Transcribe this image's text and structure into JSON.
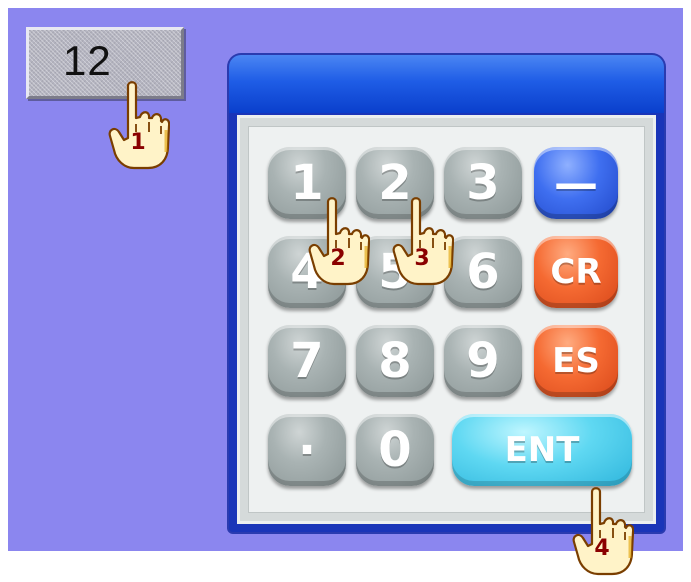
{
  "numeric_input": {
    "value": "12"
  },
  "keypad": {
    "rows": [
      [
        {
          "label": "1",
          "name": "key-1",
          "style": "gray"
        },
        {
          "label": "2",
          "name": "key-2",
          "style": "gray"
        },
        {
          "label": "3",
          "name": "key-3",
          "style": "gray"
        },
        {
          "label": "—",
          "name": "key-minus",
          "style": "blue"
        }
      ],
      [
        {
          "label": "4",
          "name": "key-4",
          "style": "gray"
        },
        {
          "label": "5",
          "name": "key-5",
          "style": "gray"
        },
        {
          "label": "6",
          "name": "key-6",
          "style": "gray"
        },
        {
          "label": "CR",
          "name": "key-clear",
          "style": "orange"
        }
      ],
      [
        {
          "label": "7",
          "name": "key-7",
          "style": "gray"
        },
        {
          "label": "8",
          "name": "key-8",
          "style": "gray"
        },
        {
          "label": "9",
          "name": "key-9",
          "style": "gray"
        },
        {
          "label": "ES",
          "name": "key-escape",
          "style": "orange"
        }
      ],
      [
        {
          "label": "·",
          "name": "key-decimal",
          "style": "gray"
        },
        {
          "label": "0",
          "name": "key-0",
          "style": "gray"
        },
        {
          "label": "ENT",
          "name": "key-enter",
          "style": "cyan"
        }
      ]
    ]
  },
  "step_markers": [
    {
      "number": "1",
      "icon": "pointing-hand-icon"
    },
    {
      "number": "2",
      "icon": "pointing-hand-icon"
    },
    {
      "number": "3",
      "icon": "pointing-hand-icon"
    },
    {
      "number": "4",
      "icon": "pointing-hand-icon"
    }
  ],
  "colors": {
    "background": "#8b86ef",
    "title_bar": "#1f5de6",
    "key_gray": "#a9b3b3",
    "key_blue": "#3f6ff0",
    "key_orange": "#f56a32",
    "key_cyan": "#5fd8f2",
    "step_number": "#8a0000",
    "hand_fill": "#fff3c8"
  }
}
